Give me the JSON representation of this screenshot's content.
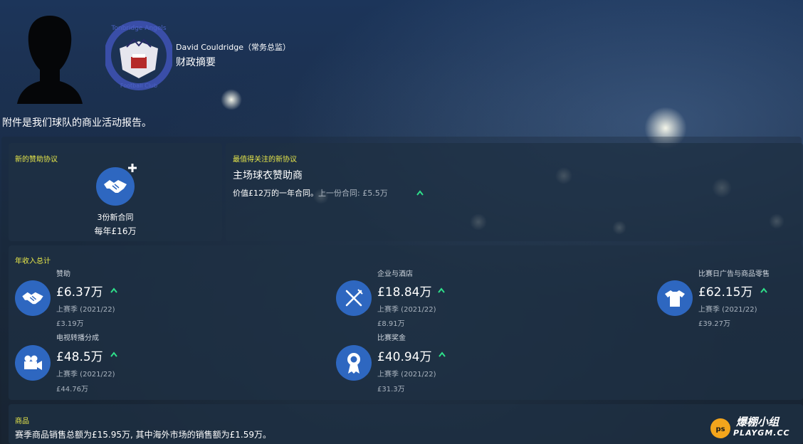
{
  "header": {
    "person_name": "David Couldridge（常务总监）",
    "title": "财政摘要",
    "intro": "附件是我们球队的商业活动报告。"
  },
  "sponsorship": {
    "label": "新的赞助协议",
    "count_text": "3份新合同",
    "annual_text": "每年£16万"
  },
  "notable": {
    "label": "最值得关注的新协议",
    "title": "主场球衣赞助商",
    "detail_main": "价值£12万的一年合同。",
    "detail_prev": "上一份合同: £5.5万"
  },
  "income": {
    "label": "年收入总计",
    "items": [
      {
        "name": "赞助",
        "value": "£6.37万",
        "prev_label": "上赛季 (2021/22)",
        "prev_value": "£3.19万",
        "icon": "handshake-icon"
      },
      {
        "name": "企业与酒店",
        "value": "£18.84万",
        "prev_label": "上赛季 (2021/22)",
        "prev_value": "£8.91万",
        "icon": "cutlery-icon"
      },
      {
        "name": "比赛日广告与商品零售",
        "value": "£62.15万",
        "prev_label": "上赛季 (2021/22)",
        "prev_value": "£39.27万",
        "icon": "shirt-icon"
      },
      {
        "name": "电视转播分成",
        "value": "£48.5万",
        "prev_label": "上赛季 (2021/22)",
        "prev_value": "£44.76万",
        "icon": "camera-icon"
      },
      {
        "name": "比赛奖金",
        "value": "£40.94万",
        "prev_label": "上赛季 (2021/22)",
        "prev_value": "£31.3万",
        "icon": "rosette-icon"
      }
    ]
  },
  "merchandise": {
    "label": "商品",
    "text": "赛季商品销售总额为£15.95万, 其中海外市场的销售额为£1.59万。"
  },
  "watermark": {
    "brand": "爆棚小组",
    "site": "PLAYGM.CC"
  },
  "colors": {
    "accent_yellow": "#e8e84a",
    "icon_blue": "#2e67c0",
    "up_green": "#2ee08a"
  }
}
